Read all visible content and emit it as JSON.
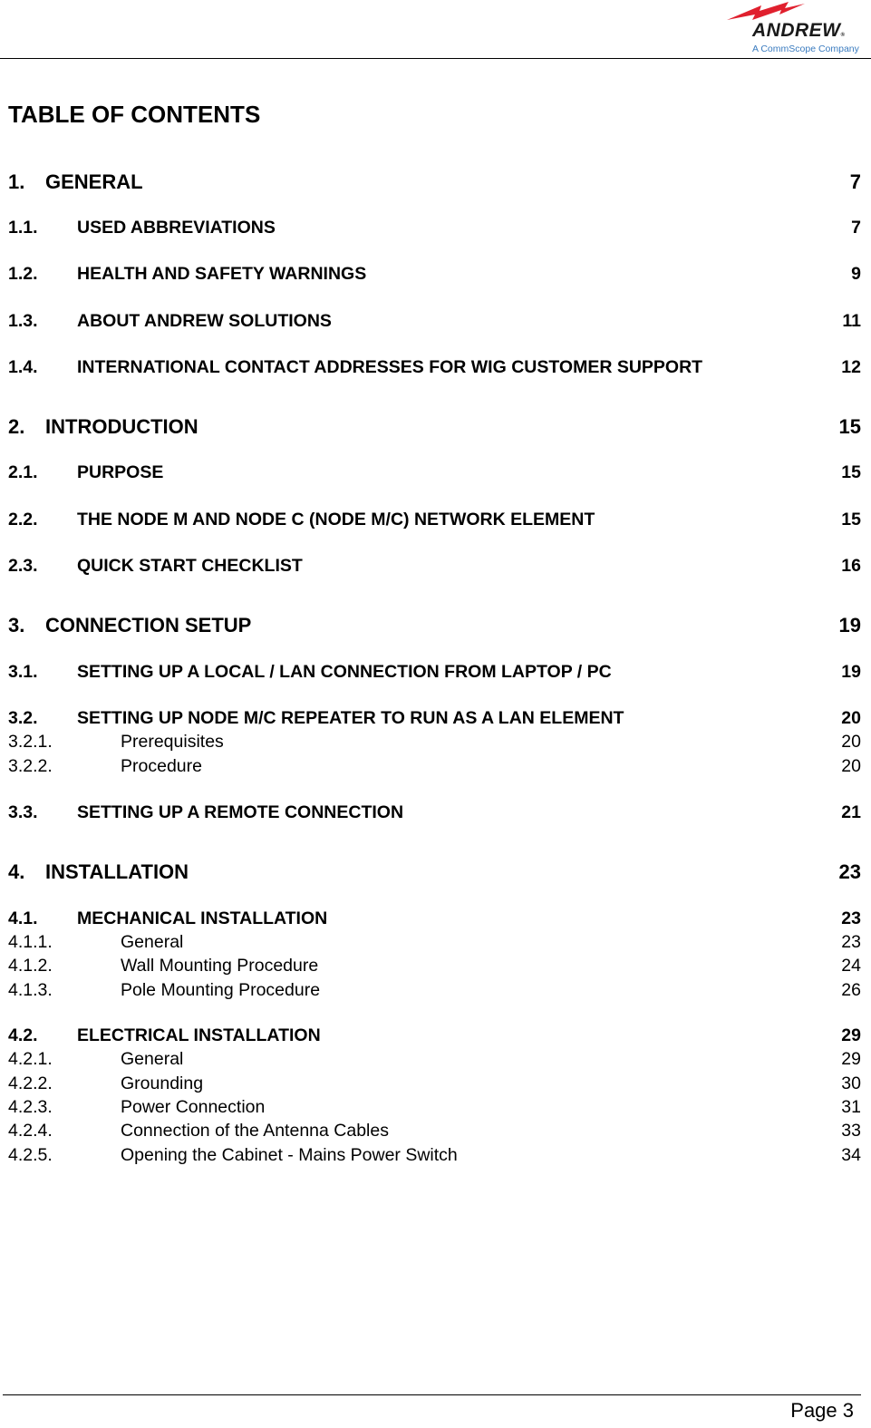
{
  "header": {
    "logo": {
      "brand": "ANDREW",
      "registered": "®",
      "tagline": "A CommScope Company",
      "icon": "lightning-bolt-icon",
      "bolt_color": "#e0202e",
      "tagline_color": "#3a7bbf"
    }
  },
  "toc": {
    "title": "TABLE OF CONTENTS",
    "entries": [
      {
        "level": 1,
        "num": "1.",
        "label": "GENERAL",
        "page": "7"
      },
      {
        "level": 2,
        "num": "1.1.",
        "label": "USED ABBREVIATIONS",
        "page": "7"
      },
      {
        "level": 2,
        "num": "1.2.",
        "label": "HEALTH AND SAFETY WARNINGS",
        "page": "9"
      },
      {
        "level": 2,
        "num": "1.3.",
        "label": "ABOUT ANDREW SOLUTIONS",
        "page": "11"
      },
      {
        "level": 2,
        "num": "1.4.",
        "label": "INTERNATIONAL CONTACT ADDRESSES FOR WIG CUSTOMER SUPPORT",
        "page": "12"
      },
      {
        "level": 1,
        "num": "2.",
        "label": "INTRODUCTION",
        "page": "15"
      },
      {
        "level": 2,
        "num": "2.1.",
        "label": "PURPOSE",
        "page": "15"
      },
      {
        "level": 2,
        "num": "2.2.",
        "label": "THE NODE M AND NODE C (NODE M/C) NETWORK ELEMENT",
        "page": "15"
      },
      {
        "level": 2,
        "num": "2.3.",
        "label": "QUICK START CHECKLIST",
        "page": "16"
      },
      {
        "level": 1,
        "num": "3.",
        "label": "CONNECTION SETUP",
        "page": "19"
      },
      {
        "level": 2,
        "num": "3.1.",
        "label": "SETTING UP A LOCAL / LAN CONNECTION FROM LAPTOP / PC",
        "page": "19"
      },
      {
        "level": 2,
        "num": "3.2.",
        "label": "SETTING UP NODE M/C REPEATER TO RUN AS A LAN ELEMENT",
        "page": "20"
      },
      {
        "level": 3,
        "num": "3.2.1.",
        "label": "Prerequisites",
        "page": "20"
      },
      {
        "level": 3,
        "num": "3.2.2.",
        "label": "Procedure",
        "page": "20"
      },
      {
        "level": 2,
        "num": "3.3.",
        "label": "SETTING UP A REMOTE CONNECTION",
        "page": "21"
      },
      {
        "level": 1,
        "num": "4.",
        "label": "INSTALLATION",
        "page": "23"
      },
      {
        "level": 2,
        "num": "4.1.",
        "label": "MECHANICAL INSTALLATION",
        "page": "23"
      },
      {
        "level": 3,
        "num": "4.1.1.",
        "label": "General",
        "page": "23"
      },
      {
        "level": 3,
        "num": "4.1.2.",
        "label": "Wall Mounting Procedure",
        "page": "24"
      },
      {
        "level": 3,
        "num": "4.1.3.",
        "label": "Pole Mounting Procedure",
        "page": "26"
      },
      {
        "level": 2,
        "num": "4.2.",
        "label": "ELECTRICAL INSTALLATION",
        "page": "29"
      },
      {
        "level": 3,
        "num": "4.2.1.",
        "label": "General",
        "page": "29"
      },
      {
        "level": 3,
        "num": "4.2.2.",
        "label": "Grounding",
        "page": "30"
      },
      {
        "level": 3,
        "num": "4.2.3.",
        "label": "Power Connection",
        "page": "31"
      },
      {
        "level": 3,
        "num": "4.2.4.",
        "label": "Connection of the Antenna Cables",
        "page": "33"
      },
      {
        "level": 3,
        "num": "4.2.5.",
        "label": "Opening the Cabinet - Mains Power Switch",
        "page": "34"
      }
    ]
  },
  "footer": {
    "page_label": "Page 3"
  }
}
